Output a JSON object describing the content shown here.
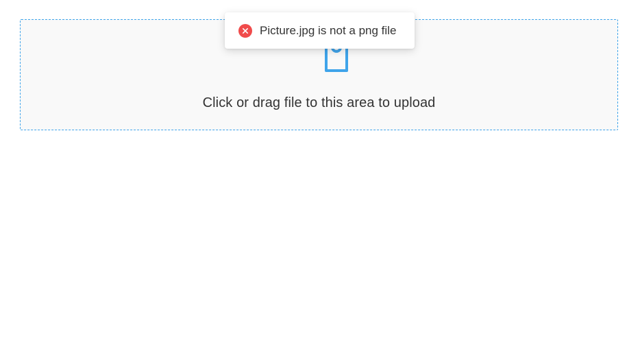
{
  "upload": {
    "hint_text": "Click or drag file to this area to upload",
    "icon": "inbox-icon",
    "accent_color": "#3fa4ea"
  },
  "message": {
    "text": "Picture.jpg is not a png file",
    "type": "error",
    "icon": "close-circle-icon",
    "icon_color": "#f04b4b"
  }
}
